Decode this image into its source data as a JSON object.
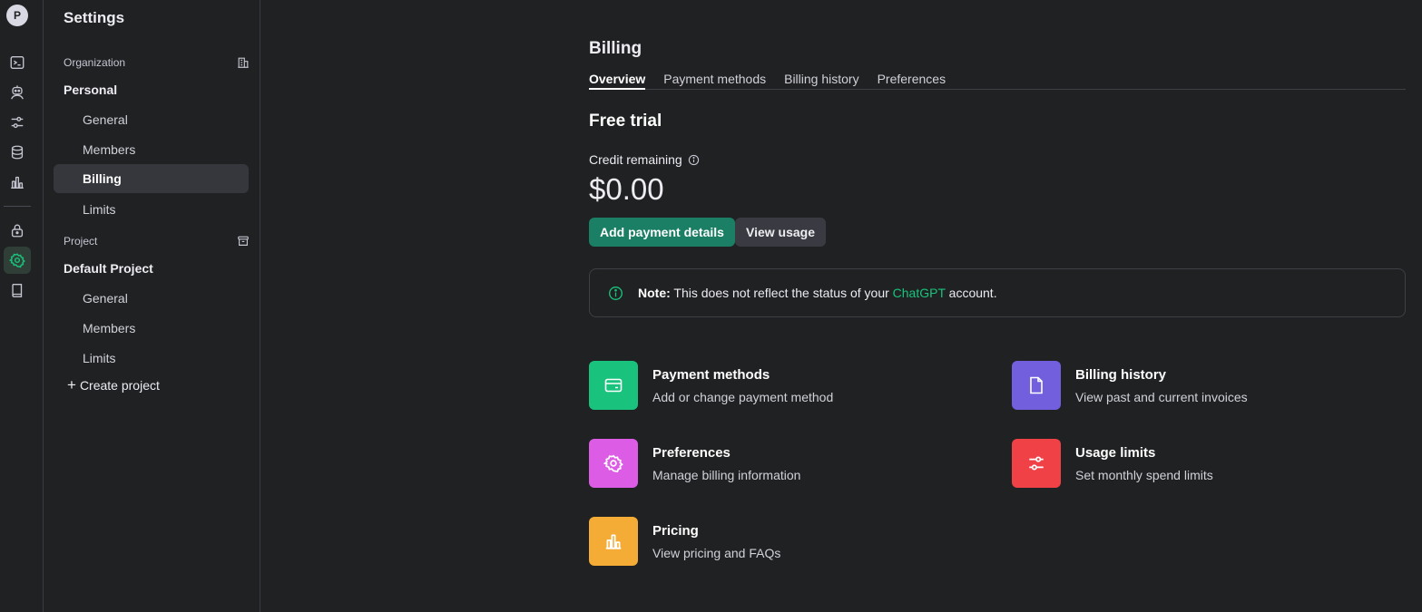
{
  "rail": {
    "avatar_letter": "P",
    "icons": [
      "terminal-icon",
      "assistant-icon",
      "sliders-icon",
      "database-icon",
      "bar-chart-icon",
      "lock-icon",
      "gear-icon",
      "book-icon"
    ],
    "active_icon": "gear-icon",
    "active_color": "#19c37d"
  },
  "sidebar": {
    "title": "Settings",
    "organization_label": "Organization",
    "organization_name": "Personal",
    "org_items": [
      {
        "label": "General"
      },
      {
        "label": "Members"
      },
      {
        "label": "Billing"
      },
      {
        "label": "Limits"
      }
    ],
    "active_item": "Billing",
    "project_label": "Project",
    "project_name": "Default Project",
    "project_items": [
      {
        "label": "General"
      },
      {
        "label": "Members"
      },
      {
        "label": "Limits"
      }
    ],
    "create_project_label": "Create project"
  },
  "main": {
    "title": "Billing",
    "tabs": [
      {
        "label": "Overview",
        "active": true
      },
      {
        "label": "Payment methods",
        "active": false
      },
      {
        "label": "Billing history",
        "active": false
      },
      {
        "label": "Preferences",
        "active": false
      }
    ],
    "plan_title": "Free trial",
    "credit_label": "Credit remaining",
    "credit_value": "$0.00",
    "add_payment_label": "Add payment details",
    "view_usage_label": "View usage",
    "note": {
      "prefix": "Note:",
      "text_before": "This does not reflect the status of your",
      "link": "ChatGPT",
      "text_after": "account."
    },
    "cards": [
      {
        "title": "Payment methods",
        "desc": "Add or change payment method",
        "color": "#19c37d",
        "icon": "credit-card-icon"
      },
      {
        "title": "Billing history",
        "desc": "View past and current invoices",
        "color": "#715fde",
        "icon": "document-icon"
      },
      {
        "title": "Preferences",
        "desc": "Manage billing information",
        "color": "#dd5ce5",
        "icon": "gear-icon"
      },
      {
        "title": "Usage limits",
        "desc": "Set monthly spend limits",
        "color": "#ef4146",
        "icon": "sliders-icon"
      },
      {
        "title": "Pricing",
        "desc": "View pricing and FAQs",
        "color": "#f4ac36",
        "icon": "bar-chart-icon"
      }
    ]
  }
}
